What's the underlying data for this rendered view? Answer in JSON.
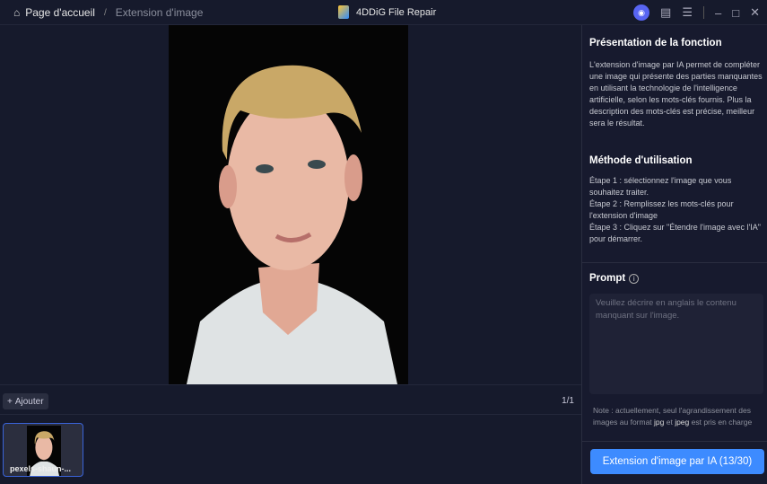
{
  "header": {
    "home_label": "Page d'accueil",
    "separator": "/",
    "current": "Extension d'image",
    "app_title": "4DDiG File Repair"
  },
  "toolbar": {
    "add_label": "Ajouter",
    "page_count": "1/1"
  },
  "thumbnails": [
    {
      "filename": "pexels-shaun-..."
    }
  ],
  "panel": {
    "intro_title": "Présentation de la fonction",
    "intro_text": "L'extension d'image par IA permet de compléter une image qui présente des parties manquantes en utilisant la technologie de l'intelligence artificielle, selon les mots-clés fournis. Plus la description des mots-clés est précise, meilleur sera le résultat.",
    "method_title": "Méthode d'utilisation",
    "steps": [
      "Étape 1 : sélectionnez l'image que vous souhaitez traiter.",
      "Étape 2 : Remplissez les mots-clés pour l'extension d'image",
      "Étape 3 : Cliquez sur \"Étendre l'image avec l'IA\" pour démarrer."
    ],
    "prompt_label": "Prompt",
    "prompt_placeholder": "Veuillez décrire en anglais le contenu manquant sur l'image.",
    "prompt_value": "",
    "note_prefix": "Note : actuellement, seul l'agrandissement des images au format ",
    "note_jpg": "jpg",
    "note_mid": " et ",
    "note_jpeg": "jpeg",
    "note_suffix": " est pris en charge",
    "action_button": "Extension d'image par IA (13/30)"
  },
  "colors": {
    "accent": "#3d8bff",
    "background": "#161a2c",
    "discord": "#5865f2"
  }
}
